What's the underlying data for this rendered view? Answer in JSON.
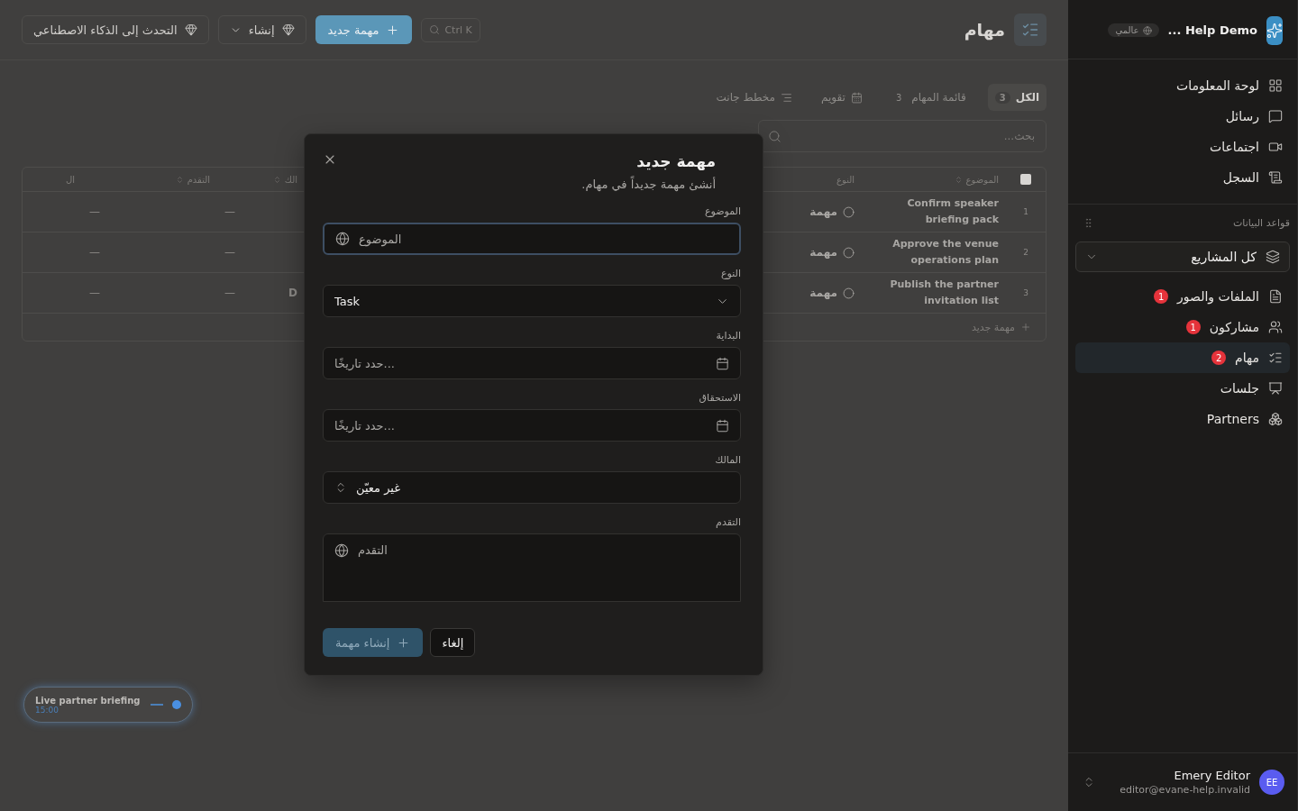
{
  "sidebar": {
    "app_name": "Help Demo ...",
    "scope_badge": "عالمي",
    "nav": [
      {
        "kind": "dashboard",
        "label": "لوحة المعلومات"
      },
      {
        "kind": "messages",
        "label": "رسائل"
      },
      {
        "kind": "meetings",
        "label": "اجتماعات"
      },
      {
        "kind": "log",
        "label": "السجل"
      }
    ],
    "section_title": "قواعد البيانات",
    "project_select": "كل المشاريع",
    "databases": [
      {
        "kind": "files",
        "label": "الملفات والصور",
        "count": "1",
        "selected": false
      },
      {
        "kind": "people",
        "label": "مشاركون",
        "count": "1",
        "selected": false
      },
      {
        "kind": "tasks",
        "label": "مهام",
        "count": "2",
        "selected": true
      },
      {
        "kind": "sessions",
        "label": "جلسات",
        "selected": false
      },
      {
        "kind": "partners",
        "label": "Partners",
        "selected": false
      }
    ],
    "user": {
      "name": "Emery Editor",
      "email": "editor@evane-help.invalid",
      "initials": "EE"
    }
  },
  "header": {
    "title": "مهام",
    "search_shortcut": "Ctrl K",
    "new_button": "مهمة جديد",
    "create_button": "إنشاء",
    "ai_button": "التحدث إلى الذكاء الاصطناعي"
  },
  "views": [
    {
      "kind": "all",
      "label": "الكل",
      "count": "3",
      "selected": true
    },
    {
      "kind": "list",
      "label": "قائمة المهام",
      "count": "3",
      "selected": false
    },
    {
      "kind": "calendar",
      "label": "تقويم",
      "selected": false
    },
    {
      "kind": "gantt",
      "label": "مخطط جانت",
      "selected": false
    }
  ],
  "search": {
    "placeholder": "بحث..."
  },
  "table": {
    "select_all_checked": false,
    "columns": [
      "الموضوع",
      "النوع",
      "الك",
      "التقدم",
      "ال"
    ],
    "rows": [
      {
        "number": "1",
        "subject": "Confirm speaker briefing pack",
        "type": "مهمة",
        "owner": "—",
        "progress": "—"
      },
      {
        "number": "2",
        "subject": "Approve the venue operations plan",
        "type": "مهمة",
        "owner": "—",
        "progress": "—"
      },
      {
        "number": "3",
        "subject": "Publish the partner invitation list",
        "type": "مهمة",
        "cut": "D",
        "owner": "—",
        "progress": "—"
      }
    ],
    "add_row": "مهمة جديد"
  },
  "live_pill": {
    "title": "Live partner briefing",
    "time": "15:00"
  },
  "dialog": {
    "title": "مهمة جديد",
    "subtitle": "أنشئ مهمة جديداً في مهام.",
    "fields": [
      {
        "kind": "text",
        "label": "الموضوع",
        "placeholder": "الموضوع",
        "focused": true
      },
      {
        "kind": "select",
        "label": "النوع",
        "value": "Task"
      },
      {
        "kind": "date",
        "label": "البداية",
        "placeholder": "حدد تاريخًا..."
      },
      {
        "kind": "date",
        "label": "الاستحقاق",
        "placeholder": "حدد تاريخًا..."
      },
      {
        "kind": "combo",
        "label": "المالك",
        "value": "غير معيّن"
      },
      {
        "kind": "textarea",
        "label": "التقدم",
        "placeholder": "التقدم"
      }
    ],
    "submit": "إنشاء مهمة",
    "cancel": "إلغاء"
  }
}
